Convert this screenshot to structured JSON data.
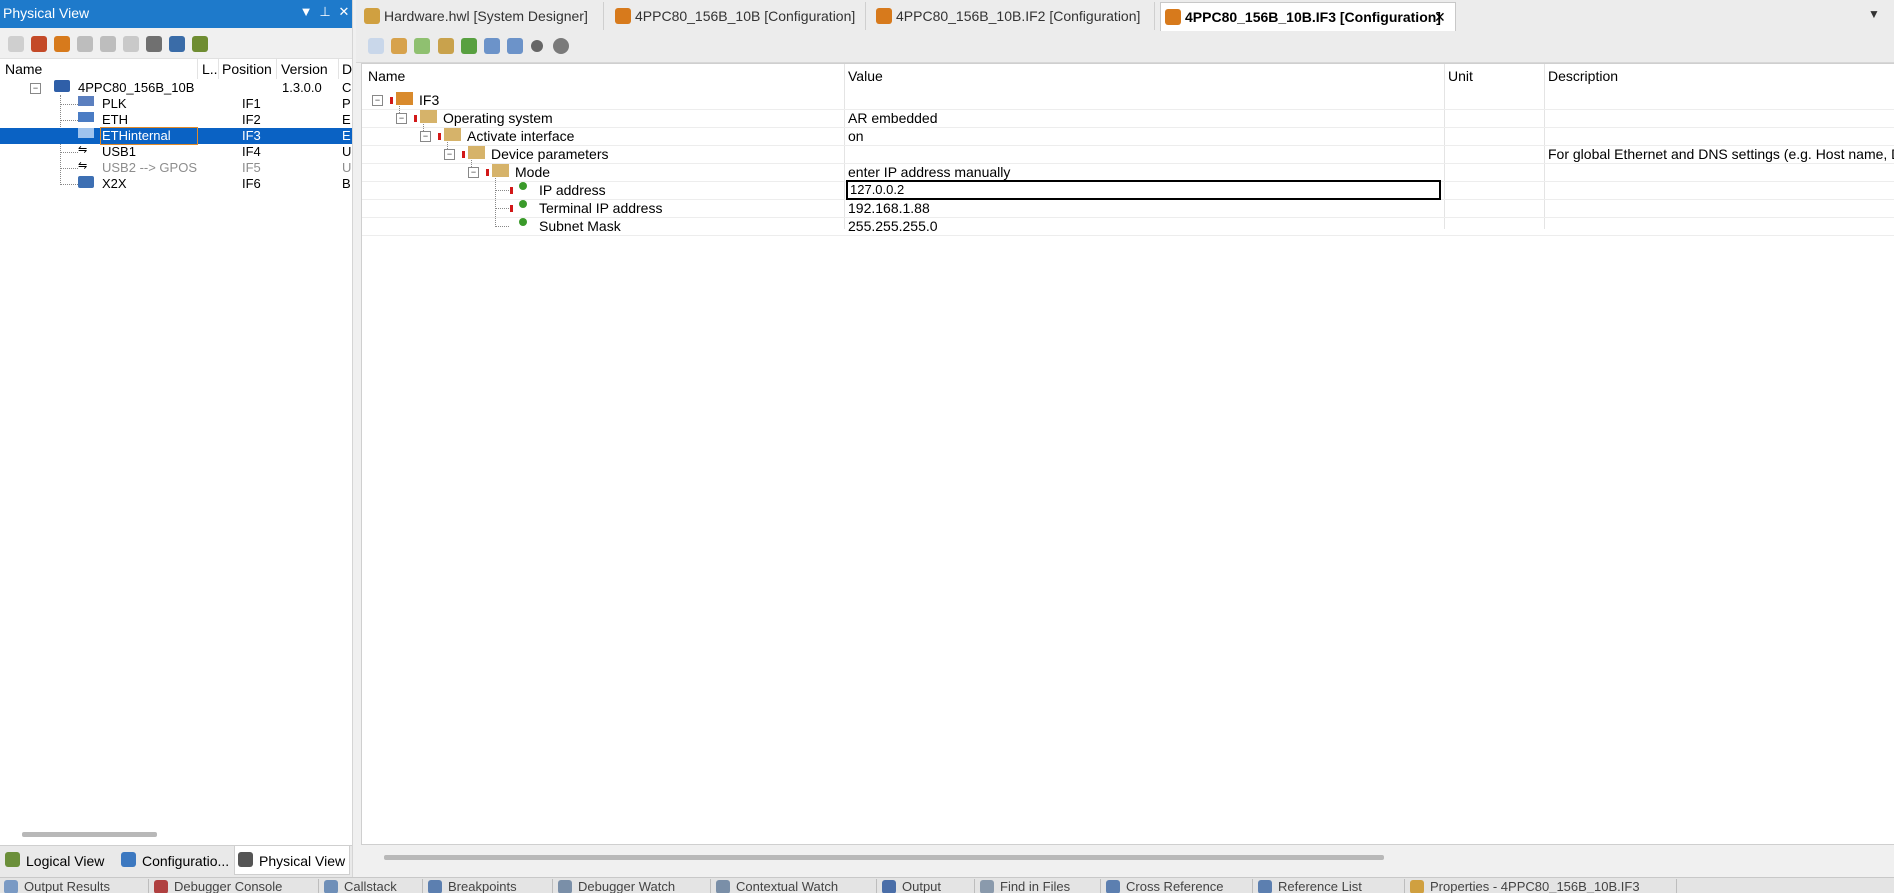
{
  "left_panel": {
    "title": "Physical View",
    "controls": {
      "dropdown": "▼",
      "pin": "⊥",
      "close": "✕"
    },
    "columns": [
      "Name",
      "L..",
      "Position",
      "Version",
      "D"
    ],
    "tree": [
      {
        "name": "4PPC80_156B_10B",
        "position": "",
        "version": "1.3.0.0",
        "desc": "C",
        "icon": "pc-icon",
        "selected": false,
        "disabled": false
      },
      {
        "name": "PLK",
        "position": "IF1",
        "version": "",
        "desc": "P",
        "icon": "powerlink-icon",
        "selected": false,
        "disabled": false
      },
      {
        "name": "ETH",
        "position": "IF2",
        "version": "",
        "desc": "E",
        "icon": "ethernet-icon",
        "selected": false,
        "disabled": false
      },
      {
        "name": "ETHinternal",
        "position": "IF3",
        "version": "",
        "desc": "E",
        "icon": "ethernet-icon",
        "selected": true,
        "disabled": false
      },
      {
        "name": "USB1",
        "position": "IF4",
        "version": "",
        "desc": "U",
        "icon": "usb-icon",
        "selected": false,
        "disabled": false
      },
      {
        "name": "USB2 --> GPOS",
        "position": "IF5",
        "version": "",
        "desc": "U",
        "icon": "usb-icon",
        "selected": false,
        "disabled": true
      },
      {
        "name": "X2X",
        "position": "IF6",
        "version": "",
        "desc": "B",
        "icon": "x2x-icon",
        "selected": false,
        "disabled": false
      }
    ],
    "bottom_tabs": [
      {
        "label": "Logical View",
        "active": false
      },
      {
        "label": "Configuratio...",
        "active": false
      },
      {
        "label": "Physical View",
        "active": true
      }
    ]
  },
  "doc_tabs": [
    {
      "label": "Hardware.hwl [System Designer]",
      "active": false
    },
    {
      "label": "4PPC80_156B_10B [Configuration]",
      "active": false
    },
    {
      "label": "4PPC80_156B_10B.IF2 [Configuration]",
      "active": false
    },
    {
      "label": "4PPC80_156B_10B.IF3 [Configuration]",
      "active": true
    }
  ],
  "doc_tabs_close": "✕",
  "doc_tabs_menu": "▼",
  "grid": {
    "columns": [
      "Name",
      "Value",
      "Unit",
      "Description"
    ],
    "rows": [
      {
        "name": "IF3",
        "value": "",
        "unit": "",
        "description": ""
      },
      {
        "name": "Operating system",
        "value": "AR embedded",
        "unit": "",
        "description": ""
      },
      {
        "name": "Activate interface",
        "value": "on",
        "unit": "",
        "description": ""
      },
      {
        "name": "Device parameters",
        "value": "",
        "unit": "",
        "description": "For global Ethernet and DNS settings (e.g. Host name, DI"
      },
      {
        "name": "Mode",
        "value": "enter IP address manually",
        "unit": "",
        "description": ""
      },
      {
        "name": "IP address",
        "value": "127.0.0.2",
        "unit": "",
        "description": ""
      },
      {
        "name": "Terminal IP address",
        "value": "192.168.1.88",
        "unit": "",
        "description": ""
      },
      {
        "name": "Subnet Mask",
        "value": "255.255.255.0",
        "unit": "",
        "description": ""
      }
    ]
  },
  "bottom_strip_tabs": [
    "Output Results",
    "Debugger Console",
    "Callstack",
    "Breakpoints",
    "Debugger Watch",
    "Contextual Watch",
    "Output",
    "Find in Files",
    "Cross Reference",
    "Reference List",
    "Properties - 4PPC80_156B_10B.IF3"
  ],
  "colors": {
    "accent": "#1e7acb",
    "selection": "#0a62c4",
    "required_marker": "#d21818",
    "leaf_dot": "#3a9a2a"
  }
}
